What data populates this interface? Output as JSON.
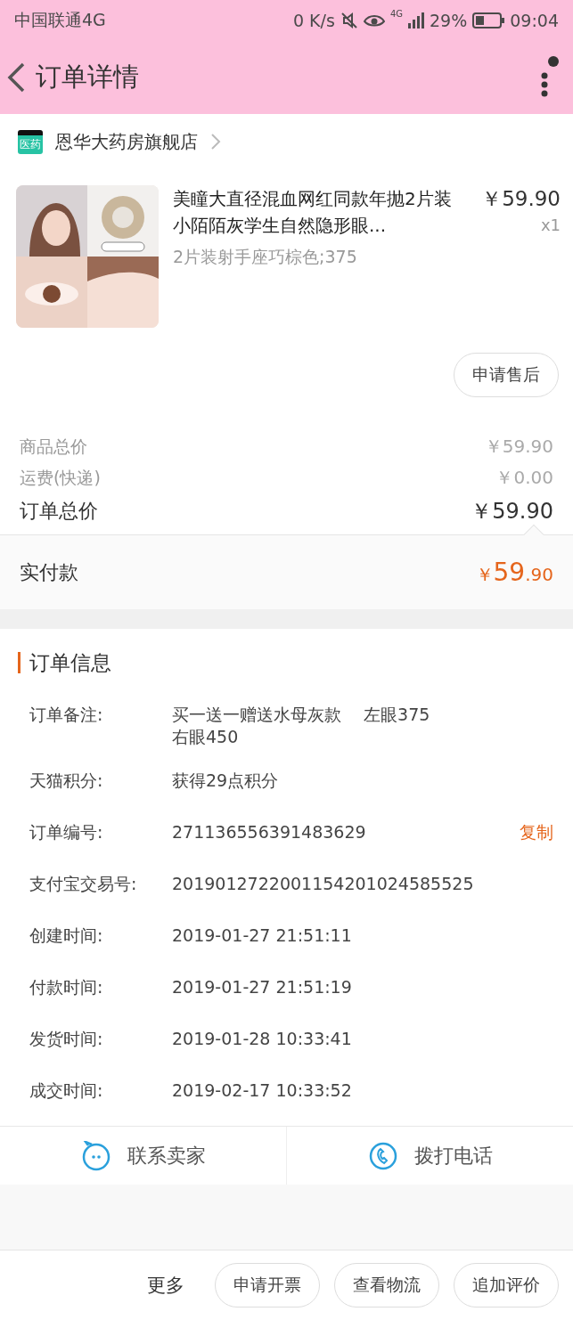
{
  "status_bar": {
    "carrier": "中国联通4G",
    "speed": "0 K/s",
    "network": "4G",
    "battery": "29%",
    "time": "09:04"
  },
  "header": {
    "title": "订单详情"
  },
  "store": {
    "name": "恩华大药房旗舰店",
    "badge": "医药"
  },
  "product": {
    "kind": "picture",
    "title": "美瞳大直径混血网红同款年抛2片装小陌陌灰学生自然隐形眼...",
    "price": "￥59.90",
    "quantity": "x1",
    "sku": "2片装射手座巧棕色;375",
    "after_sale": "申请售后"
  },
  "costs": [
    {
      "label": "商品总价",
      "value": "￥59.90",
      "kind": "minor"
    },
    {
      "label": "运费(快递)",
      "value": "￥0.00",
      "kind": "minor"
    },
    {
      "label": "订单总价",
      "value": "￥59.90",
      "kind": "major"
    }
  ],
  "paid": {
    "label": "实付款",
    "currency": "￥",
    "integer": "59",
    "decimal": ".90"
  },
  "order_info": {
    "title": "订单信息",
    "rows": [
      {
        "label": "订单备注:",
        "value": "买一送一赠送水母灰款　 左眼375\n右眼450"
      },
      {
        "label": "天猫积分:",
        "value": "获得29点积分"
      },
      {
        "label": "订单编号:",
        "value": "271136556391483629",
        "action": "复制"
      },
      {
        "label": "支付宝交易号:",
        "value": "2019012722001154201024585525"
      },
      {
        "label": "创建时间:",
        "value": "2019-01-27 21:51:11"
      },
      {
        "label": "付款时间:",
        "value": "2019-01-27 21:51:19"
      },
      {
        "label": "发货时间:",
        "value": "2019-01-28 10:33:41"
      },
      {
        "label": "成交时间:",
        "value": "2019-02-17 10:33:52"
      }
    ]
  },
  "contact": [
    {
      "label": "联系卖家",
      "kind": "chat"
    },
    {
      "label": "拨打电话",
      "kind": "phone"
    }
  ],
  "bottom_bar": {
    "more": "更多",
    "buttons": [
      "申请开票",
      "查看物流",
      "追加评价"
    ]
  }
}
